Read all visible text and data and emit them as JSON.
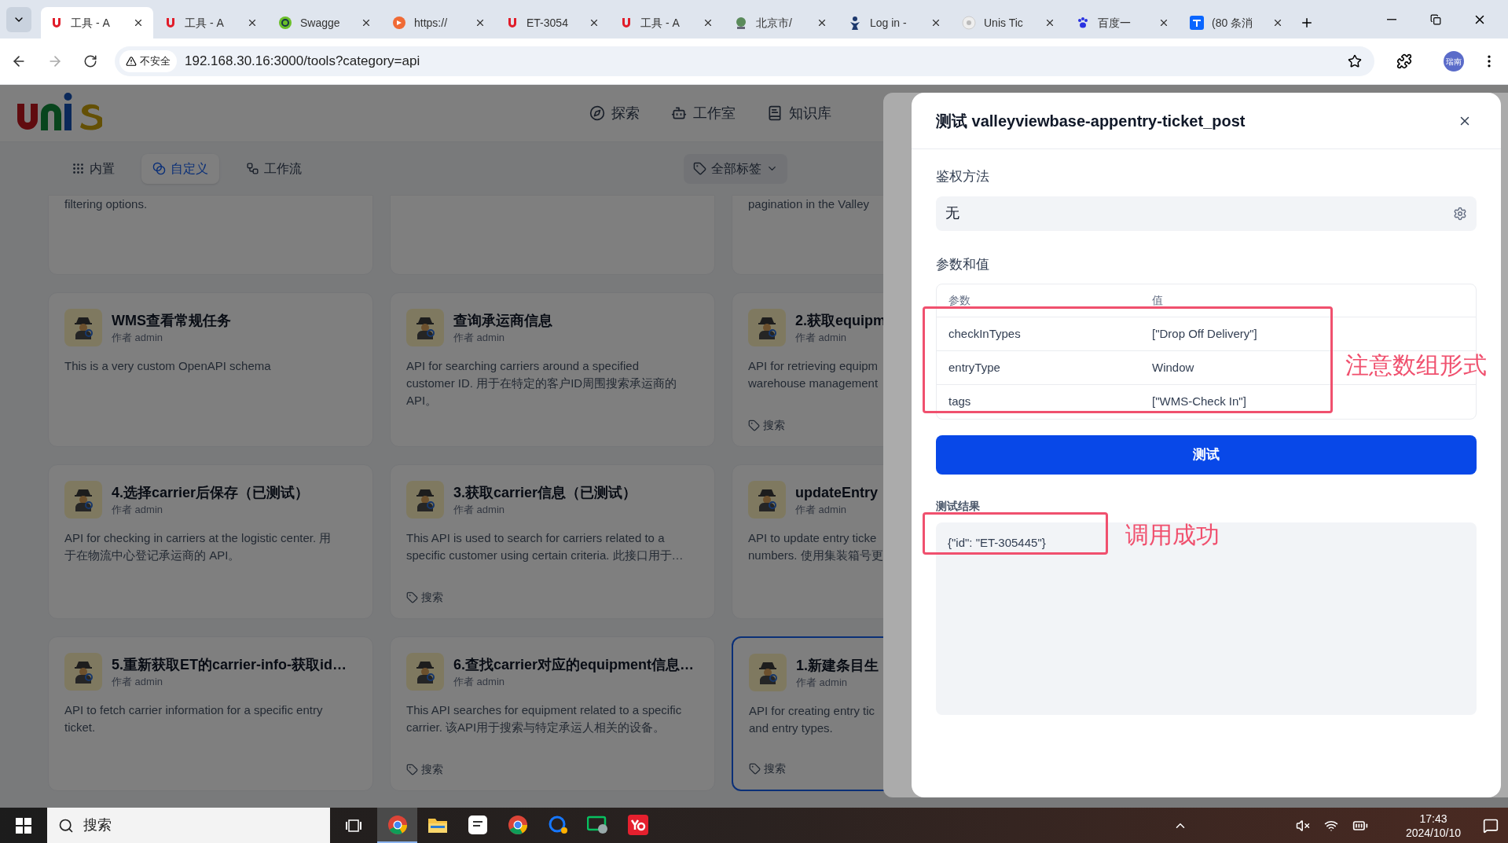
{
  "browser": {
    "tabs": [
      {
        "title": "工具 - A",
        "kind": "unis",
        "selected": true
      },
      {
        "title": "工具 - A",
        "kind": "unis",
        "selected": false
      },
      {
        "title": "Swagge",
        "kind": "swagger",
        "selected": false
      },
      {
        "title": "https://",
        "kind": "gitlab",
        "selected": false
      },
      {
        "title": "ET-3054",
        "kind": "unis",
        "selected": false
      },
      {
        "title": "工具 - A",
        "kind": "unis",
        "selected": false
      },
      {
        "title": "北京市/",
        "kind": "globe",
        "selected": false
      },
      {
        "title": "Log in -",
        "kind": "person",
        "selected": false
      },
      {
        "title": "Unis Tic",
        "kind": "disc",
        "selected": false
      },
      {
        "title": "百度一",
        "kind": "paw",
        "selected": false
      },
      {
        "title": "(80 条消",
        "kind": "zhihu",
        "selected": false
      }
    ],
    "security_label": "不安全",
    "url": "192.168.30.16:3000/tools?category=api",
    "profile": "瑞南"
  },
  "app": {
    "nav": [
      {
        "label": "探索",
        "kind": "compass"
      },
      {
        "label": "工作室",
        "kind": "bot"
      },
      {
        "label": "知识库",
        "kind": "book"
      }
    ],
    "categories": [
      {
        "label": "内置",
        "kind": "grid",
        "selected": false
      },
      {
        "label": "自定义",
        "kind": "circles",
        "selected": true
      },
      {
        "label": "工作流",
        "kind": "flow",
        "selected": false
      }
    ],
    "tag_filter": "全部标签",
    "cards": [
      {
        "description": [
          "filtering options."
        ],
        "selected": false
      },
      {
        "selected": false
      },
      {
        "description": [
          "pagination in the Valley"
        ],
        "selected": false
      },
      {
        "title": "WMS查看常规任务",
        "author": "作者 admin",
        "description": [
          "This is a very custom OpenAPI schema"
        ],
        "selected": false
      },
      {
        "title": "查询承运商信息",
        "author": "作者 admin",
        "description": [
          "API for searching carriers around a specified",
          "customer ID. 用于在特定的客户ID周围搜索承运商的",
          "API。"
        ],
        "selected": false
      },
      {
        "title": "2.获取equipm",
        "author": "作者 admin",
        "description": [
          "API for retrieving equipm",
          "warehouse management"
        ],
        "tag": "搜索",
        "selected": false
      },
      {
        "title": "4.选择carrier后保存（已测试）",
        "author": "作者 admin",
        "description": [
          "API for checking in carriers at the logistic center. 用",
          "于在物流中心登记承运商的 API。"
        ],
        "selected": false
      },
      {
        "title": "3.获取carrier信息（已测试）",
        "author": "作者 admin",
        "description": [
          "This API is used to search for carriers related to a",
          "specific customer using certain criteria. 此接口用于…"
        ],
        "tag": "搜索",
        "selected": false
      },
      {
        "title": "updateEntry",
        "author": "作者 admin",
        "description": [
          "API to update entry ticke",
          "numbers. 使用集装箱号更"
        ],
        "selected": false
      },
      {
        "title": "5.重新获取ET的carrier-info-获取id…",
        "author": "作者 admin",
        "description": [
          "API to fetch carrier information for a specific entry",
          "ticket."
        ],
        "selected": false
      },
      {
        "title": "6.查找carrier对应的equipment信息…",
        "author": "作者 admin",
        "description": [
          "This API searches for equipment related to a specific",
          "carrier. 该API用于搜索与特定承运人相关的设备。"
        ],
        "tag": "搜索",
        "selected": false
      },
      {
        "title": "1.新建条目生",
        "author": "作者 admin",
        "description": [
          "API for creating entry tic",
          "and entry types."
        ],
        "tag": "搜索",
        "selected": true
      }
    ]
  },
  "modal": {
    "title": "测试 valleyviewbase-appentry-ticket_post",
    "auth_label": "鉴权方法",
    "auth_value": "无",
    "params_label": "参数和值",
    "columns": [
      "参数",
      "值"
    ],
    "rows": [
      {
        "param": "checkInTypes",
        "value": "[\"Drop Off Delivery\"]"
      },
      {
        "param": "entryType",
        "value": "Window"
      },
      {
        "param": "tags",
        "value": "[\"WMS-Check In\"]"
      }
    ],
    "test_button": "测试",
    "result_label": "测试结果",
    "result": "{\"id\": \"ET-305445\"}",
    "annotations": [
      "注意数组形式",
      "调用成功"
    ]
  },
  "taskbar": {
    "search_placeholder": "搜索",
    "apps": [
      {
        "kind": "chrome",
        "selected": true
      },
      {
        "kind": "folder",
        "selected": false
      },
      {
        "kind": "notes",
        "selected": false
      },
      {
        "kind": "chrome",
        "selected": false
      },
      {
        "kind": "chat",
        "selected": false
      },
      {
        "kind": "message",
        "selected": false
      },
      {
        "kind": "dict",
        "selected": false
      }
    ],
    "time": "17:43",
    "date": "2024/10/10"
  }
}
